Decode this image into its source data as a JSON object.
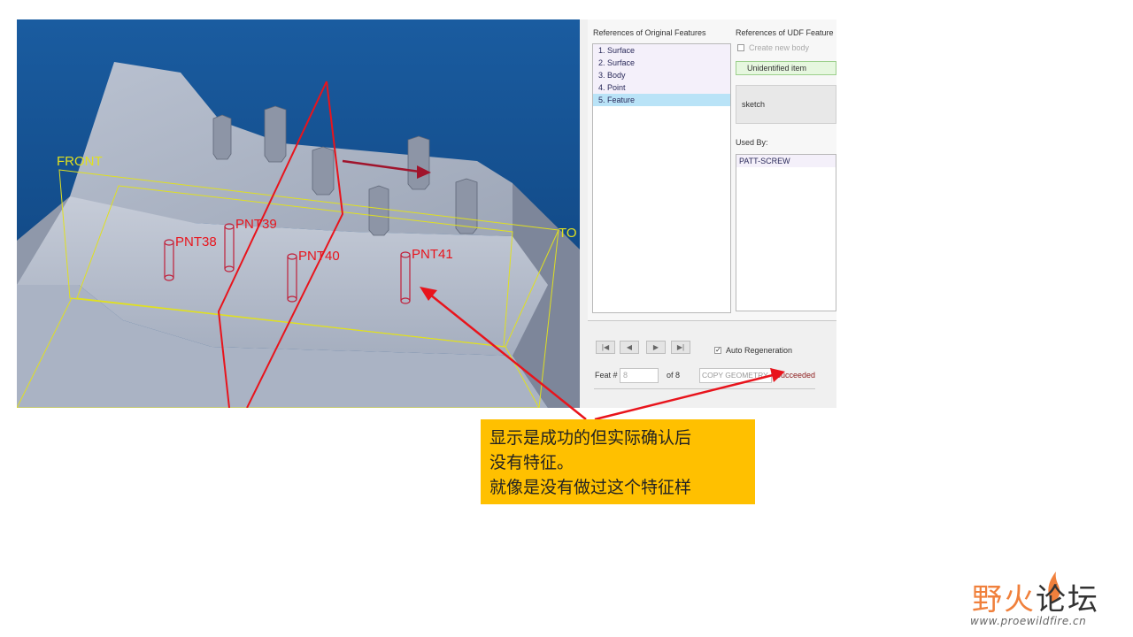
{
  "viewport": {
    "background_top": "#1a5ca0",
    "background_bottom": "#0d3f78",
    "datum_plane_labels": {
      "front": "FRONT",
      "top": "TO"
    },
    "point_labels": [
      "PNT38",
      "PNT39",
      "PNT40",
      "PNT41"
    ]
  },
  "dialog": {
    "orig_refs_title": "References of Original Features",
    "orig_refs_items": [
      "1. Surface",
      "2. Surface",
      "3. Body",
      "4. Point",
      "5. Feature"
    ],
    "selected_index": 4,
    "udf_refs_title": "References of UDF Feature",
    "create_new_body_label": "Create new body",
    "create_new_body_checked": false,
    "unidentified_item": "Unidentified item",
    "sketch_label": "sketch",
    "used_by_title": "Used By:",
    "used_by_items": [
      "PATT-SCREW"
    ],
    "nav_buttons": [
      "|◀",
      "◀",
      "▶",
      "▶|"
    ],
    "auto_regeneration_label": "Auto Regeneration",
    "auto_regeneration_checked": true,
    "feat_label": "Feat #",
    "feat_value": "8",
    "feat_of": "of 8",
    "feature_type": "COPY GEOMETRY",
    "status": "Succeeded"
  },
  "callout": {
    "lines": [
      "显示是成功的但实际确认后",
      "没有特征。",
      "就像是没有做过这个特征样"
    ],
    "background": "#ffc000"
  },
  "logo": {
    "text_accent": "野火",
    "text_main": "论坛",
    "url": "www.proewildfire.cn",
    "accent_color": "#f0803c"
  },
  "colors": {
    "annotation_red": "#e8141c",
    "datum_yellow": "#e0e020",
    "part_gray": "#a9b2c3"
  }
}
